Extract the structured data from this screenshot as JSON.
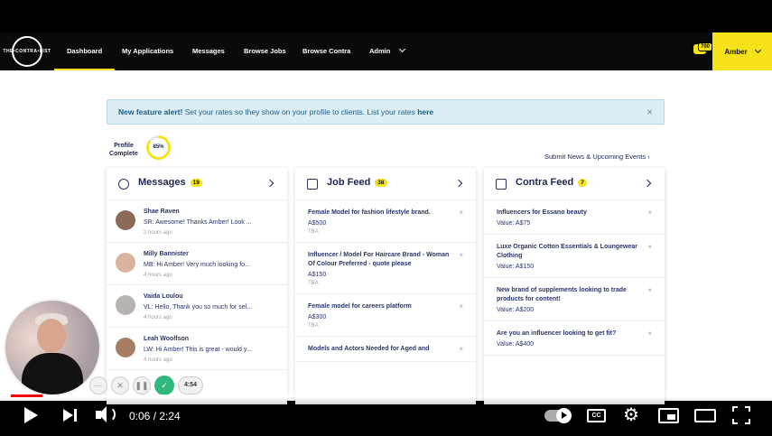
{
  "logo": {
    "text": "THE•CONTRA•LIST"
  },
  "nav": {
    "items": [
      {
        "label": "Dashboard",
        "active": true
      },
      {
        "label": "My Applications"
      },
      {
        "label": "Messages"
      },
      {
        "label": "Browse Jobs"
      },
      {
        "label": "Browse Contra"
      },
      {
        "label": "Admin"
      }
    ],
    "chat_count": "700",
    "user_name": "Amber"
  },
  "alert": {
    "bold": "New feature alert!",
    "text": " Set your rates so they show on your profile to clients. List your rates ",
    "link": "here",
    "close": "×"
  },
  "profile": {
    "label_line1": "Profile",
    "label_line2": "Complete",
    "percent": "85%",
    "percent_value": 0.85
  },
  "submit_link": "Submit News & Upcoming Events ›",
  "messages": {
    "title": "Messages",
    "count": "19",
    "items": [
      {
        "name": "Shae Raven",
        "text": "SR: Awesome! Thanks Amber! Look ...",
        "time": "2 hours ago"
      },
      {
        "name": "Milly Bannister",
        "text": "MB: Hi Amber! Very much looking fo...",
        "time": "4 hours ago"
      },
      {
        "name": "Vaida Loulou",
        "text": "VL: Hello, Thank you so much for sel...",
        "time": "4 hours ago"
      },
      {
        "name": "Leah Woolfson",
        "text": "LW: Hi Amber! This is great - would y...",
        "time": "4 hours ago"
      }
    ]
  },
  "job_feed": {
    "title": "Job Feed",
    "count": "38",
    "items": [
      {
        "title": "Female Model for fashion lifestyle brand.",
        "line": "A$500",
        "sub": "TBA"
      },
      {
        "title": "Influencer / Model For Haircare Brand - Woman Of Colour Preferred - quote please",
        "line": "A$150",
        "sub": "TBA"
      },
      {
        "title": "Female model for careers platform",
        "line": "A$300",
        "sub": "TBA"
      },
      {
        "title": "Models and Actors Needed for Aged and",
        "line": "",
        "sub": ""
      }
    ]
  },
  "contra_feed": {
    "title": "Contra Feed",
    "count": "7",
    "items": [
      {
        "title": "Influencers for Essano beauty",
        "line": "Value: A$75"
      },
      {
        "title": "Luxe Organic Cotton Essentials & Loungewear Clothing",
        "line": "Value: A$150"
      },
      {
        "title": "New brand of supplements looking to trade products for content!",
        "line": "Value: A$200"
      },
      {
        "title": "Are you an influencer looking to get fit?",
        "line": "Value: A$400"
      }
    ]
  },
  "recorder": {
    "timer": "4:54"
  },
  "player": {
    "time": "0:06 / 2:24",
    "played_fraction": 0.042,
    "buffered_fraction": 0.47,
    "cc_label": "CC"
  },
  "colors": {
    "accent": "#f5e21a",
    "navy": "#1c2550",
    "alert_bg": "#dcedf6",
    "progress": "#ff0000"
  }
}
